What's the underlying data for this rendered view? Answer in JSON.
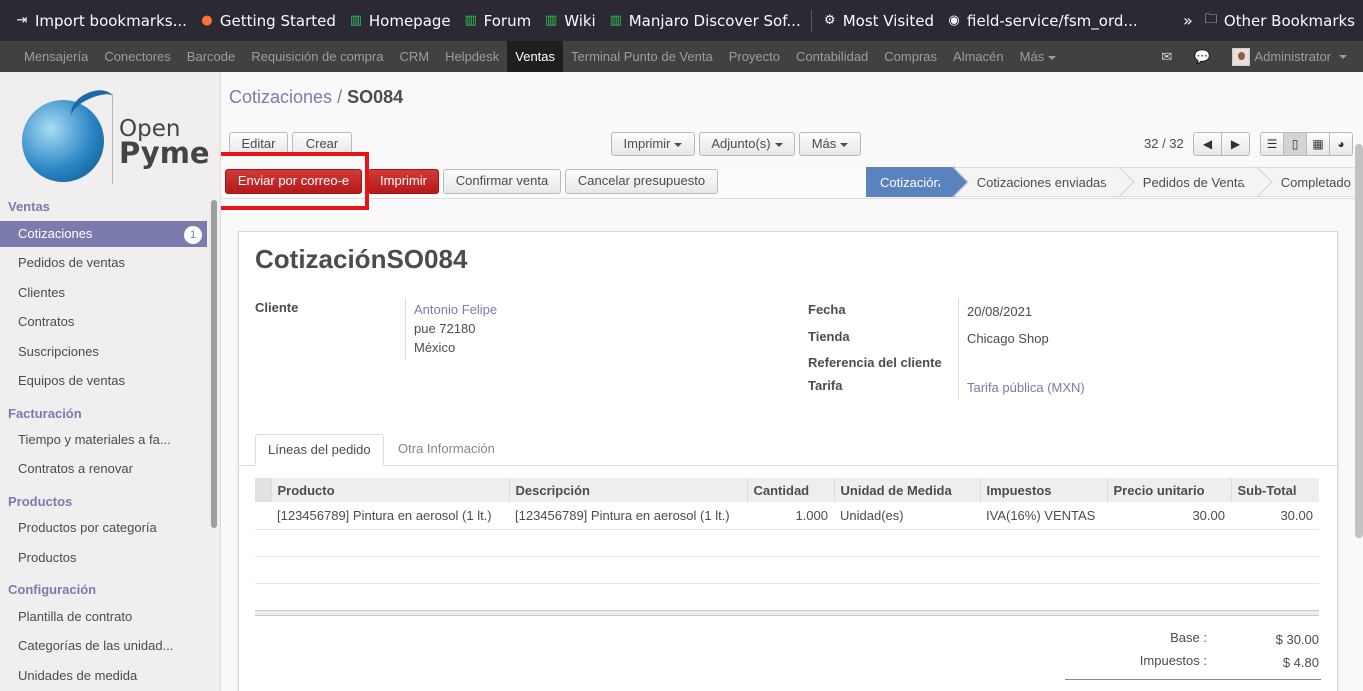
{
  "browser": {
    "bookmarks": [
      {
        "label": "Import bookmarks...",
        "icon": "import-icon"
      },
      {
        "label": "Getting Started",
        "icon": "firefox-icon"
      },
      {
        "label": "Homepage",
        "icon": "manjaro-icon"
      },
      {
        "label": "Forum",
        "icon": "manjaro-icon"
      },
      {
        "label": "Wiki",
        "icon": "manjaro-icon"
      },
      {
        "label": "Manjaro Discover Sof...",
        "icon": "manjaro-icon"
      },
      {
        "label": "Most Visited",
        "icon": "gear-icon"
      },
      {
        "label": "field-service/fsm_ord...",
        "icon": "github-icon"
      }
    ],
    "other_bookmarks": "Other Bookmarks"
  },
  "topnav": {
    "items": [
      "Mensajería",
      "Conectores",
      "Barcode",
      "Requisición de compra",
      "CRM",
      "Helpdesk",
      "Ventas",
      "Terminal Punto de Venta",
      "Proyecto",
      "Contabilidad",
      "Compras",
      "Almacén",
      "Más"
    ],
    "active": "Ventas",
    "user": "Administrator"
  },
  "sidebar": {
    "logo_line1": "Open",
    "logo_line2": "Pyme",
    "sections": [
      {
        "title": "Ventas",
        "items": [
          {
            "label": "Cotizaciones",
            "badge": "1",
            "active": true
          },
          {
            "label": "Pedidos de ventas"
          },
          {
            "label": "Clientes"
          },
          {
            "label": "Contratos"
          },
          {
            "label": "Suscripciones"
          },
          {
            "label": "Equipos de ventas"
          }
        ]
      },
      {
        "title": "Facturación",
        "items": [
          {
            "label": "Tiempo y materiales a fa..."
          },
          {
            "label": "Contratos a renovar"
          }
        ]
      },
      {
        "title": "Productos",
        "items": [
          {
            "label": "Productos por categoría"
          },
          {
            "label": "Productos"
          }
        ]
      },
      {
        "title": "Configuración",
        "items": [
          {
            "label": "Plantilla de contrato"
          },
          {
            "label": "Categorías de las unidad..."
          },
          {
            "label": "Unidades de medida"
          }
        ]
      }
    ]
  },
  "control": {
    "breadcrumb_parent": "Cotizaciones",
    "breadcrumb_sep": "/",
    "breadcrumb_current": "SO084",
    "edit": "Editar",
    "create": "Crear",
    "print_menu": "Imprimir",
    "attach_menu": "Adjunto(s)",
    "more_menu": "Más",
    "pager": "32 / 32"
  },
  "statusbar": {
    "send_email": "Enviar por correo-e",
    "print": "Imprimir",
    "confirm": "Confirmar venta",
    "cancel": "Cancelar presupuesto",
    "stages": [
      "Cotización",
      "Cotizaciones enviadas",
      "Pedidos de Venta",
      "Completado"
    ],
    "active_stage": "Cotización"
  },
  "form": {
    "title_prefix": "Cotización",
    "title_number": "SO084",
    "customer_label": "Cliente",
    "customer_name": "Antonio Felipe",
    "customer_addr1": "pue 72180",
    "customer_addr2": "México",
    "date_label": "Fecha",
    "date_value": "20/08/2021",
    "shop_label": "Tienda",
    "shop_value": "Chicago Shop",
    "ref_label": "Referencia del cliente",
    "ref_value": "",
    "pricelist_label": "Tarifa",
    "pricelist_value": "Tarifa pública (MXN)",
    "tabs": [
      "Líneas del pedido",
      "Otra Información"
    ],
    "columns": [
      "Producto",
      "Descripción",
      "Cantidad",
      "Unidad de Medida",
      "Impuestos",
      "Precio unitario",
      "Sub-Total"
    ],
    "lines": [
      {
        "product": "[123456789] Pintura en aerosol (1 lt.)",
        "description": "[123456789] Pintura en aerosol (1 lt.)",
        "qty": "1.000",
        "uom": "Unidad(es)",
        "taxes": "IVA(16%) VENTAS",
        "price": "30.00",
        "subtotal": "30.00"
      }
    ],
    "base_label": "Base :",
    "base_value": "$ 30.00",
    "tax_label": "Impuestos :",
    "tax_value": "$ 4.80"
  }
}
